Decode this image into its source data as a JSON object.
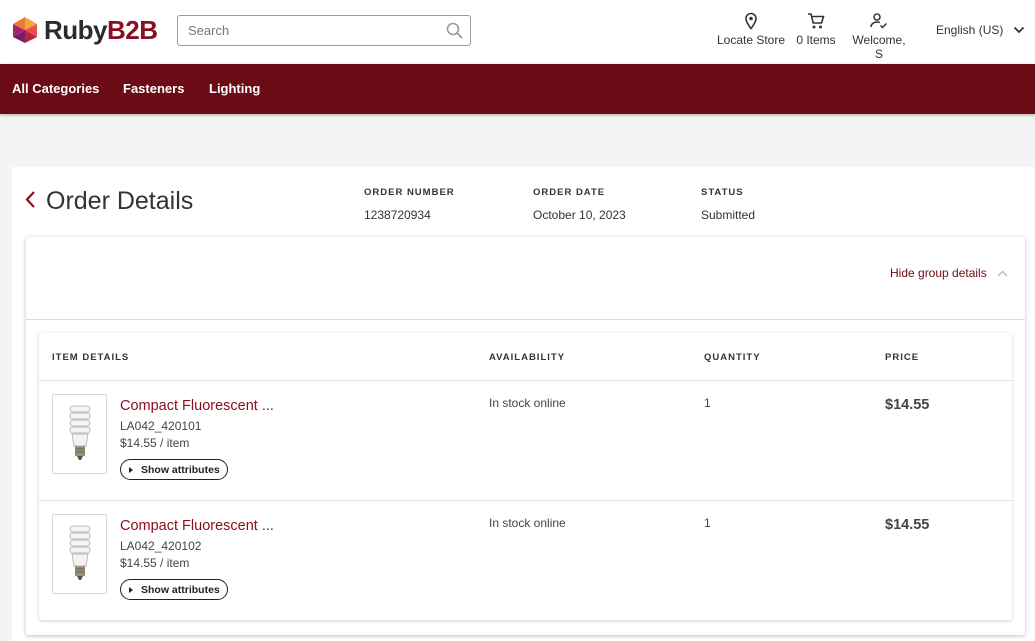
{
  "brand": {
    "name_part1": "Ruby",
    "name_part2": "B2B"
  },
  "search": {
    "placeholder": "Search"
  },
  "header": {
    "locate_store": "Locate Store",
    "cart": "0 Items",
    "welcome": "Welcome, S",
    "language": "English (US)"
  },
  "nav": {
    "items": [
      "All Categories",
      "Fasteners",
      "Lighting"
    ]
  },
  "order": {
    "title": "Order Details",
    "number_label": "ORDER NUMBER",
    "number": "1238720934",
    "date_label": "ORDER DATE",
    "date": "October 10, 2023",
    "status_label": "STATUS",
    "status": "Submitted"
  },
  "group": {
    "hide_details": "Hide group details"
  },
  "table": {
    "columns": [
      "ITEM DETAILS",
      "AVAILABILITY",
      "QUANTITY",
      "PRICE"
    ],
    "rows": [
      {
        "name": "Compact Fluorescent ...",
        "sku": "LA042_420101",
        "unit_price": "$14.55 / item",
        "attributes_button": "Show attributes",
        "availability": "In stock online",
        "quantity": "1",
        "price": "$14.55"
      },
      {
        "name": "Compact Fluorescent ...",
        "sku": "LA042_420102",
        "unit_price": "$14.55 / item",
        "attributes_button": "Show attributes",
        "availability": "In stock online",
        "quantity": "1",
        "price": "$14.55"
      }
    ]
  },
  "colors": {
    "brand": "#6b0b15",
    "accent_text": "#8a1020"
  }
}
